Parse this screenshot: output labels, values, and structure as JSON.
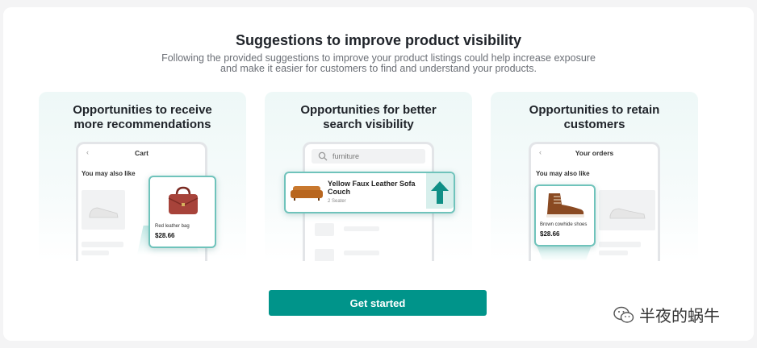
{
  "header": {
    "title": "Suggestions to improve product visibility",
    "subtitle": "Following the provided suggestions to improve your product listings could help increase exposure and make it easier for customers to find and understand your products."
  },
  "cards": [
    {
      "title": "Opportunities to receive more recommendations",
      "screen_title": "Cart",
      "section_label": "You may also like",
      "product_name": "Red leather bag",
      "product_price": "$28.66"
    },
    {
      "title": "Opportunities for better search visibility",
      "search_value": "furniture",
      "product_name": "Yellow Faux Leather Sofa Couch",
      "product_detail": "2 Seater"
    },
    {
      "title": "Opportunities to retain customers",
      "screen_title": "Your orders",
      "section_label": "You may also like",
      "product_name": "Brown cowhide shoes",
      "product_price": "$28.66"
    }
  ],
  "cta": {
    "label": "Get started"
  },
  "watermark": {
    "text": "半夜的蜗牛"
  },
  "colors": {
    "accent": "#00948a",
    "highlight_border": "#6fc3bb",
    "card_bg": "#eef8f7"
  }
}
